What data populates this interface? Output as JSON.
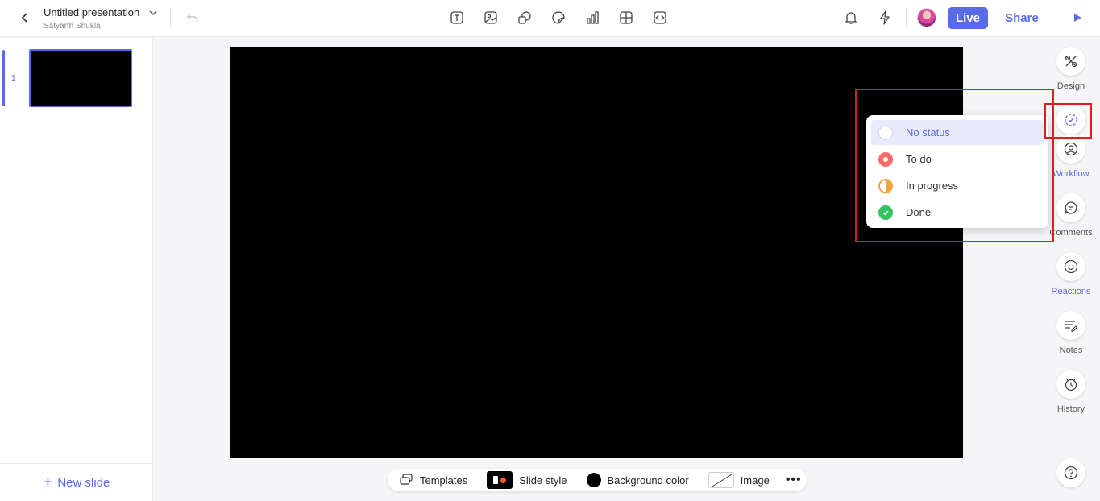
{
  "header": {
    "title": "Untitled presentation",
    "owner": "Satyarth Shukla",
    "live_label": "Live",
    "share_label": "Share"
  },
  "toolbar": {
    "tools": [
      "text-tool",
      "image-tool",
      "shape-tool",
      "sticker-tool",
      "chart-tool",
      "table-tool",
      "embed-tool"
    ]
  },
  "slides": {
    "items": [
      {
        "number": "1"
      }
    ],
    "new_slide_label": "New slide"
  },
  "bottom_bar": {
    "templates": "Templates",
    "slide_style": "Slide style",
    "background_color": "Background color",
    "image": "Image",
    "more": "•••"
  },
  "rail": {
    "design": "Design",
    "workflow": "Workflow",
    "comments": "Comments",
    "reactions": "Reactions",
    "notes": "Notes",
    "history": "History"
  },
  "status_menu": {
    "items": [
      {
        "label": "No status",
        "icon": "empty-circle-icon",
        "selected": true
      },
      {
        "label": "To do",
        "icon": "todo-icon"
      },
      {
        "label": "In progress",
        "icon": "half-circle-icon"
      },
      {
        "label": "Done",
        "icon": "check-circle-icon"
      }
    ]
  },
  "colors": {
    "accent": "#5a6be8",
    "highlight": "#e21c1c",
    "todo": "#ff6b6b",
    "progress": "#f5a442",
    "done": "#33c260"
  }
}
